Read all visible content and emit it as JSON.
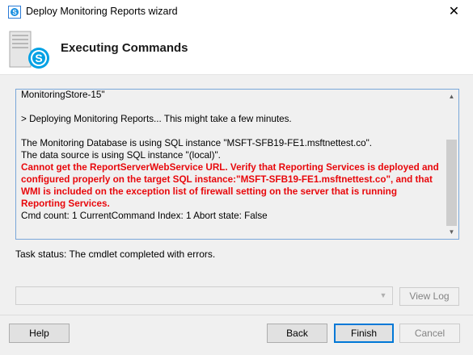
{
  "window": {
    "title": "Deploy Monitoring Reports wizard",
    "close_glyph": "✕",
    "app_icon": "skype-for-business-server-icon"
  },
  "header": {
    "title": "Executing Commands",
    "icon": "server-skype-icon"
  },
  "log": {
    "lines": [
      {
        "text": "MonitoringStore-15\"",
        "type": "normal"
      },
      {
        "text": "",
        "type": "blank"
      },
      {
        "text": "> Deploying Monitoring Reports... This might take a few minutes.",
        "type": "normal"
      },
      {
        "text": "",
        "type": "blank"
      },
      {
        "text": "The Monitoring Database is using SQL instance \"MSFT-SFB19-FE1.msftnettest.co\".",
        "type": "normal"
      },
      {
        "text": "The data source is using SQL instance \"(local)\".",
        "type": "normal"
      },
      {
        "text": "Cannot get the ReportServerWebService URL. Verify that Reporting Services is deployed and configured properly on the target SQL instance:\"MSFT-SFB19-FE1.msftnettest.co\", and that WMI is included on the exception list of firewall setting on the server that is running Reporting Services.",
        "type": "error"
      },
      {
        "text": "Cmd count: 1 CurrentCommand Index: 1 Abort state: False",
        "type": "normal"
      }
    ],
    "error_color": "#e8080c",
    "scroll_position": 0.62
  },
  "task_status": "Task status: The cmdlet completed with errors.",
  "log_selector": {
    "value": "",
    "view_log_label": "View Log"
  },
  "buttons": {
    "help": "Help",
    "back": "Back",
    "finish": "Finish",
    "cancel": "Cancel"
  },
  "colors": {
    "accent": "#0078d7",
    "skype_blue": "#00a1e4"
  }
}
